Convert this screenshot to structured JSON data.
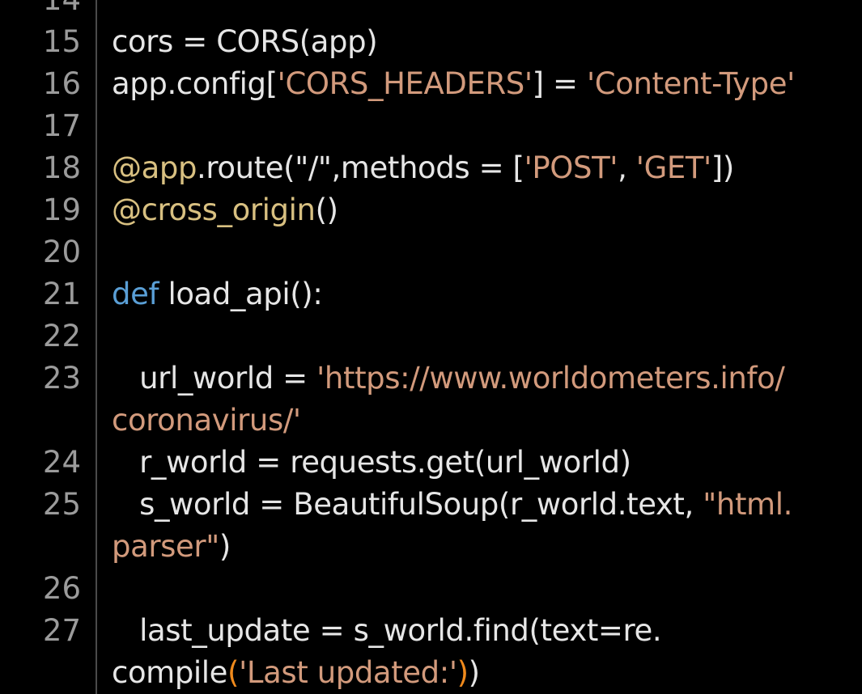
{
  "editor": {
    "theme": {
      "background": "#000000",
      "text": "#e6e6e6",
      "line_number": "#9b9b9b",
      "string": "#d29a7c",
      "keyword": "#5a9fd6",
      "decorator": "#d8c081",
      "bracket_match": "#f08a1c",
      "gutter_divider": "#4a4a4a"
    },
    "lines": [
      {
        "num": "14",
        "parts": []
      },
      {
        "num": "15",
        "parts": [
          {
            "t": "cors = CORS(app)",
            "c": "plain"
          }
        ]
      },
      {
        "num": "16",
        "parts": [
          {
            "t": "app.config[",
            "c": "plain"
          },
          {
            "t": "'CORS_HEADERS'",
            "c": "str"
          },
          {
            "t": "] = ",
            "c": "plain"
          },
          {
            "t": "'Content-Type'",
            "c": "str"
          }
        ]
      },
      {
        "num": "17",
        "parts": []
      },
      {
        "num": "18",
        "parts": [
          {
            "t": "@app",
            "c": "deco"
          },
          {
            "t": ".route(\"/\",methods = [",
            "c": "plain"
          },
          {
            "t": "'POST'",
            "c": "str"
          },
          {
            "t": ", ",
            "c": "plain"
          },
          {
            "t": "'GET'",
            "c": "str"
          },
          {
            "t": "])",
            "c": "plain"
          }
        ]
      },
      {
        "num": "19",
        "parts": [
          {
            "t": "@cross_origin",
            "c": "deco"
          },
          {
            "t": "()",
            "c": "plain"
          }
        ]
      },
      {
        "num": "20",
        "parts": []
      },
      {
        "num": "21",
        "parts": [
          {
            "t": "def",
            "c": "kw"
          },
          {
            "t": " load_api():",
            "c": "plain"
          }
        ]
      },
      {
        "num": "22",
        "parts": []
      },
      {
        "num": "23",
        "parts": [
          {
            "t": "   url_world = ",
            "c": "plain"
          },
          {
            "t": "'https://www.worldometers.info/",
            "c": "str"
          }
        ]
      },
      {
        "num": "",
        "parts": [
          {
            "t": "coronavirus/'",
            "c": "str"
          }
        ]
      },
      {
        "num": "24",
        "parts": [
          {
            "t": "   r_world = requests.get(url_world)",
            "c": "plain"
          }
        ]
      },
      {
        "num": "25",
        "parts": [
          {
            "t": "   s_world = BeautifulSoup(r_world.text, ",
            "c": "plain"
          },
          {
            "t": "\"html.",
            "c": "str"
          }
        ]
      },
      {
        "num": "",
        "parts": [
          {
            "t": "parser\"",
            "c": "str"
          },
          {
            "t": ")",
            "c": "plain"
          }
        ]
      },
      {
        "num": "26",
        "parts": []
      },
      {
        "num": "27",
        "parts": [
          {
            "t": "   last_update = s_world.find(text=re.",
            "c": "plain"
          }
        ]
      },
      {
        "num": "",
        "parts": [
          {
            "t": "compile",
            "c": "plain"
          },
          {
            "t": "(",
            "c": "paren-hl"
          },
          {
            "t": "'Last updated:'",
            "c": "str"
          },
          {
            "t": ")",
            "c": "paren-hl"
          },
          {
            "t": ")",
            "c": "plain"
          }
        ]
      }
    ]
  }
}
